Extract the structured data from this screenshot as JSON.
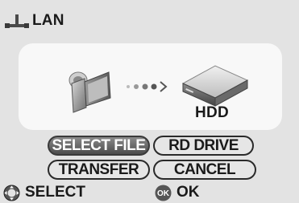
{
  "header": {
    "icon": "lan-icon",
    "title": "LAN"
  },
  "transfer_diagram": {
    "source_icon": "video-camera-icon",
    "arrow_icon": "dotted-arrow-icon",
    "destination_icon": "hdd-icon",
    "destination_label": "HDD"
  },
  "menu": {
    "select_file": "SELECT FILE",
    "rd_drive": "RD DRIVE",
    "transfer": "TRANSFER",
    "cancel": "CANCEL",
    "selected_item": "SELECT FILE"
  },
  "footer": {
    "select_icon": "direction-pad-icon",
    "select_label": "SELECT",
    "ok_icon": "ok-button-icon",
    "ok_icon_text": "OK",
    "ok_label": "OK"
  }
}
